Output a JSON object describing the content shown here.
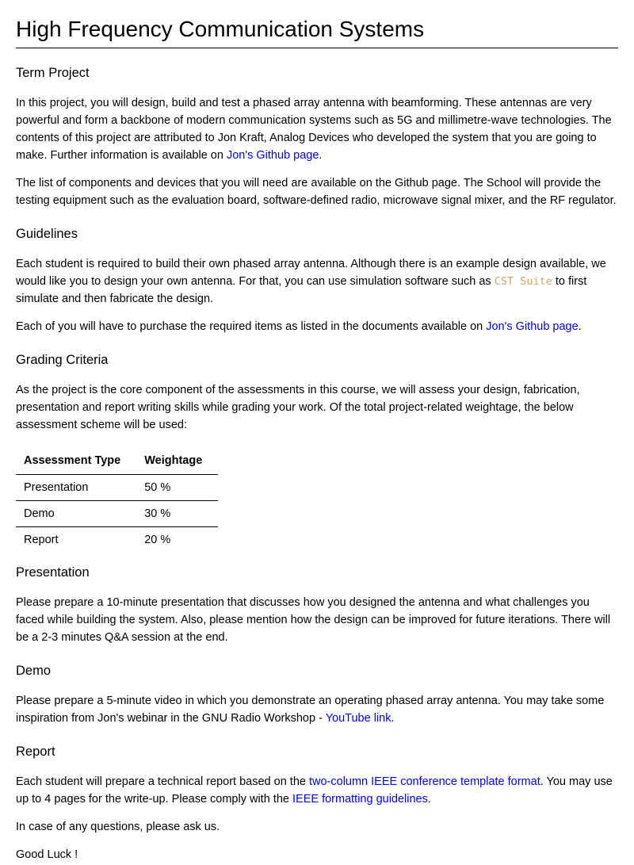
{
  "title": "High Frequency Communication Systems",
  "term_project": {
    "heading": "Term Project",
    "p1_text": "In this project, you will design, build and test a phased array antenna with beamforming. These antennas are very powerful and form a backbone of modern communication systems such as 5G and millimetre-wave technologies. The contents of this project are attributed to Jon Kraft, Analog Devices who developed the system that you are going to make. Further information is available on ",
    "p1_link": "Jon's Github page",
    "p1_end": ".",
    "p2": "The list of components and devices that you will need are available on the Github page. The School will provide the testing equipment such as the evaluation board, software-defined radio, microwave signal mixer, and the RF regulator."
  },
  "guidelines": {
    "heading": "Guidelines",
    "p1_text": "Each student is required to build their own phased array antenna. Although there is an example design available, we would like you to design your own antenna. For that, you can use simulation software such as ",
    "p1_code": "CST Suite",
    "p1_end": " to first simulate and then fabricate the design.",
    "p2_text": "Each of you will have to purchase the required items as listed in the documents available on ",
    "p2_link": "Jon's Github page",
    "p2_end": "."
  },
  "grading": {
    "heading": "Grading Criteria",
    "p1": "As the project is the core component of the assessments in this course, we will assess your design, fabrication, presentation and report writing skills while grading your work. Of the total project-related weightage, the below assessment scheme will be used:",
    "table": {
      "headers": [
        "Assessment Type",
        "Weightage"
      ],
      "rows": [
        [
          "Presentation",
          "50 %"
        ],
        [
          "Demo",
          "30 %"
        ],
        [
          "Report",
          "20 %"
        ]
      ]
    }
  },
  "presentation": {
    "heading": "Presentation",
    "p1": "Please prepare a 10-minute presentation that discusses how you designed the antenna and what challenges you faced while building the system. Also, please mention how the design can be improved for future iterations. There will be a 2-3 minutes Q&A session at the end."
  },
  "demo": {
    "heading": "Demo",
    "p1_text": "Please prepare a 5-minute video in which you demonstrate an operating phased array antenna. You may take some inspiration from Jon's webinar in the GNU Radio Workshop - ",
    "p1_link": "YouTube link",
    "p1_end": "."
  },
  "report": {
    "heading": "Report",
    "p1_text": "Each student will prepare a technical report based on the ",
    "p1_link1": "two-column IEEE conference template format",
    "p1_mid": ". You may use up to 4 pages for the write-up. Please comply with the ",
    "p1_link2": "IEEE formatting guidelines",
    "p1_end": ".",
    "p2": "In case of any questions, please ask us.",
    "p3": "Good Luck !"
  }
}
